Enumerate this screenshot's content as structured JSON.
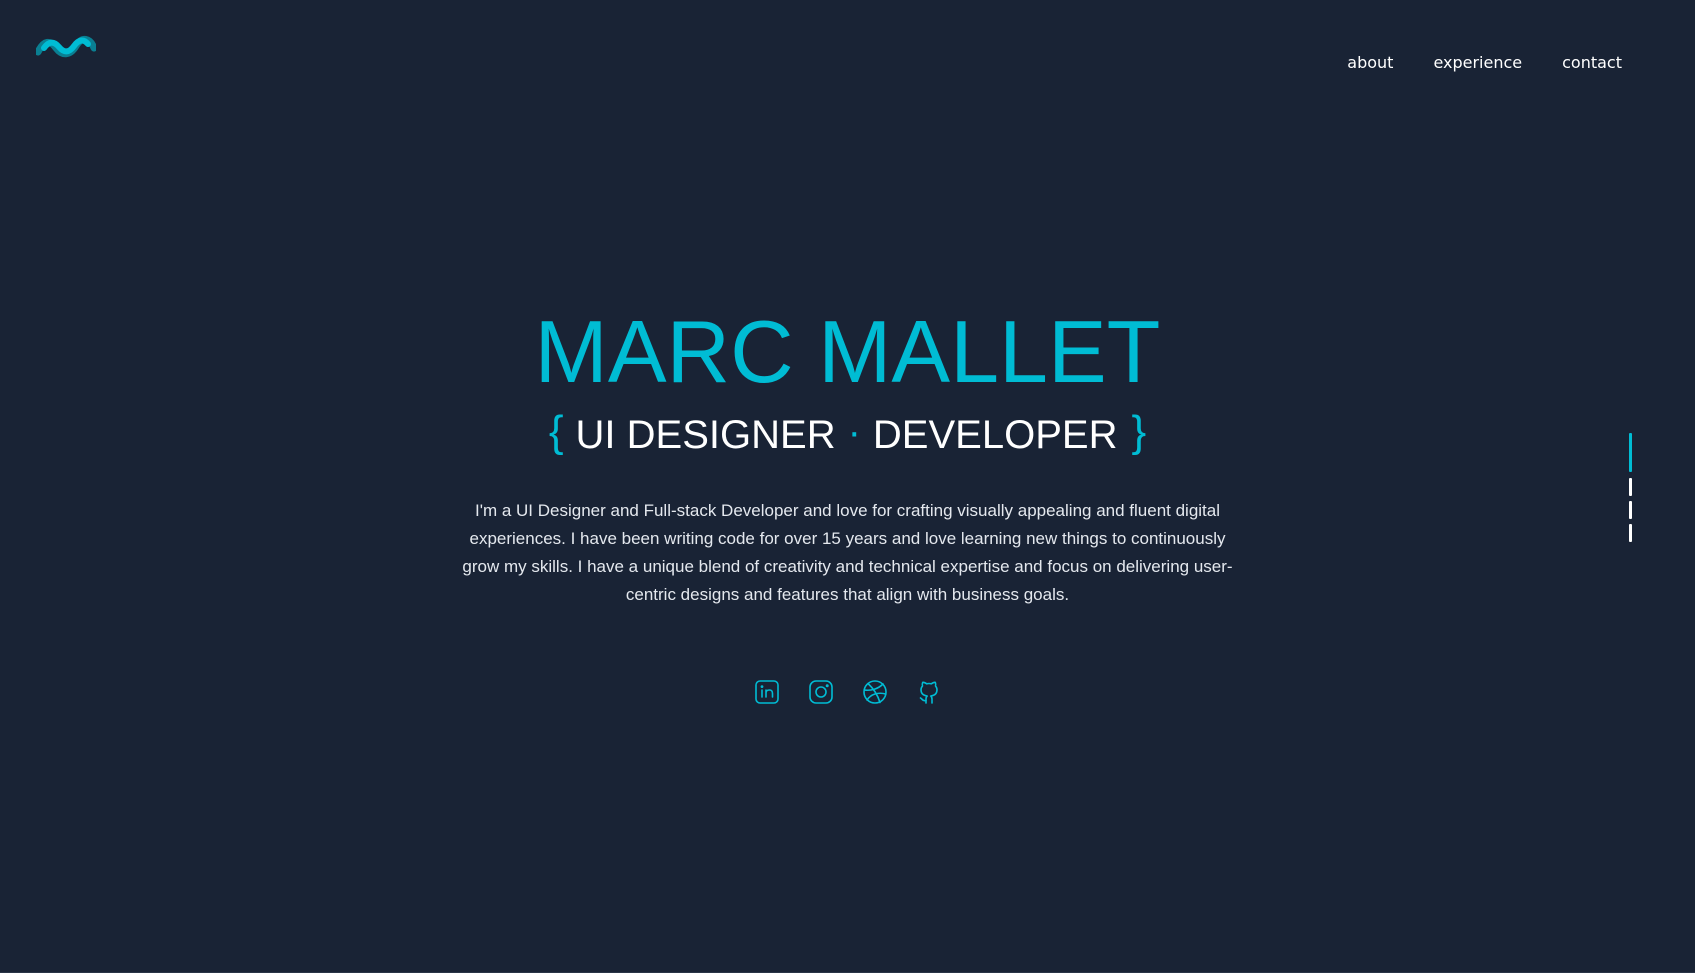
{
  "brand": {
    "logo_icon": "wave-logo-icon",
    "accent_color": "#00bcd4",
    "background_color": "#192335"
  },
  "nav": {
    "items": [
      {
        "label": "about"
      },
      {
        "label": "experience"
      },
      {
        "label": "contact"
      }
    ]
  },
  "hero": {
    "name": "MARC MALLET",
    "tagline": {
      "open_brace": "{",
      "role_1": "UI DESIGNER",
      "separator": "·",
      "role_2": "DEVELOPER",
      "close_brace": "}"
    },
    "bio": "I'm a UI Designer and Full-stack Developer and love for crafting visually appealing and fluent digital experiences. I have been writing code for over 15 years and love learning new things to continuously grow my skills. I have a unique blend of creativity and technical expertise and focus on delivering user-centric designs and features that align with business goals."
  },
  "social": [
    {
      "icon": "linkedin-icon"
    },
    {
      "icon": "instagram-icon"
    },
    {
      "icon": "dribbble-icon"
    },
    {
      "icon": "github-icon"
    }
  ],
  "section_indicator": {
    "sections": 4,
    "active_index": 0
  }
}
